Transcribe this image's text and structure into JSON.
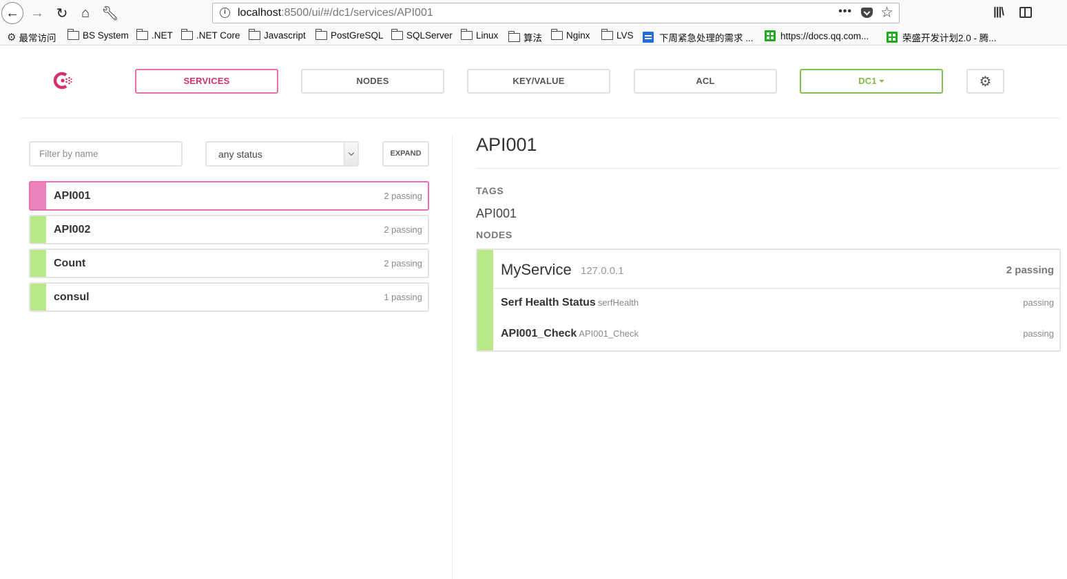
{
  "browser": {
    "url_host": "localhost",
    "url_path": ":8500/ui/#/dc1/services/API001",
    "more_glyph": "•••",
    "bookmarks": [
      {
        "label": "最常访问",
        "icon": "gear-icon"
      },
      {
        "label": "BS System",
        "icon": "folder-icon"
      },
      {
        "label": ".NET",
        "icon": "folder-icon"
      },
      {
        "label": ".NET Core",
        "icon": "folder-icon"
      },
      {
        "label": "Javascript",
        "icon": "folder-icon"
      },
      {
        "label": "PostGreSQL",
        "icon": "folder-icon"
      },
      {
        "label": "SQLServer",
        "icon": "folder-icon"
      },
      {
        "label": "Linux",
        "icon": "folder-icon"
      },
      {
        "label": "算法",
        "icon": "folder-icon"
      },
      {
        "label": "Nginx",
        "icon": "folder-icon"
      },
      {
        "label": "LVS",
        "icon": "folder-icon"
      },
      {
        "label": "下周紧急处理的需求 ...",
        "icon": "doc-icon"
      },
      {
        "label": "https://docs.qq.com...",
        "icon": "sheet-icon"
      },
      {
        "label": "荣盛开发计划2.0 - 腾...",
        "icon": "sheet-icon"
      }
    ]
  },
  "nav": {
    "services": "SERVICES",
    "nodes": "NODES",
    "keyvalue": "KEY/VALUE",
    "acl": "ACL",
    "datacenter": "DC1"
  },
  "colors": {
    "brand_pink": "#d2316c",
    "passing_green": "#b8e986",
    "active_pink": "#ec82bc"
  },
  "filter": {
    "placeholder": "Filter by name",
    "status_value": "any status",
    "expand_label": "EXPAND"
  },
  "services": [
    {
      "name": "API001",
      "count": "2 passing",
      "active": true
    },
    {
      "name": "API002",
      "count": "2 passing",
      "active": false
    },
    {
      "name": "Count",
      "count": "2 passing",
      "active": false
    },
    {
      "name": "consul",
      "count": "1 passing",
      "active": false
    }
  ],
  "detail": {
    "title": "API001",
    "tags_label": "TAGS",
    "tag": "API001",
    "nodes_label": "NODES",
    "node": {
      "name": "MyService",
      "address": "127.0.0.1",
      "count": "2 passing",
      "checks": [
        {
          "name": "Serf Health Status",
          "id": "serfHealth",
          "status": "passing"
        },
        {
          "name": "API001_Check",
          "id": "API001_Check",
          "status": "passing"
        }
      ]
    }
  }
}
